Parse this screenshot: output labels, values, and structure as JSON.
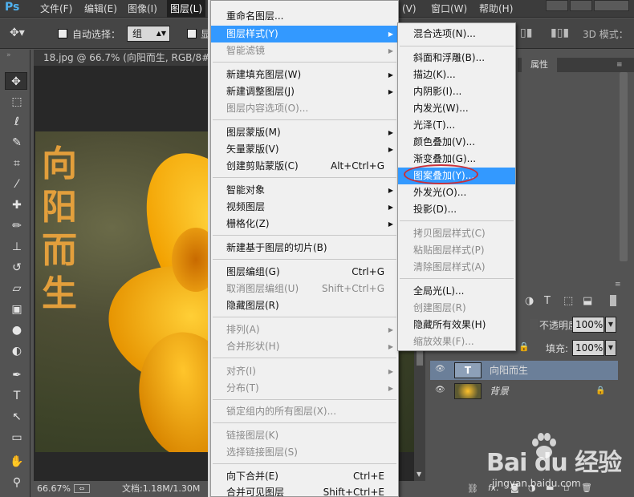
{
  "menubar": {
    "logo": "Ps",
    "items": [
      {
        "label": "文件(F)"
      },
      {
        "label": "编辑(E)"
      },
      {
        "label": "图像(I)"
      },
      {
        "label": "图层(L)"
      },
      {
        "label": "(V)"
      },
      {
        "label": "窗口(W)"
      },
      {
        "label": "帮助(H)"
      }
    ]
  },
  "options": {
    "auto_select_label": "自动选择：",
    "auto_select_value": "组",
    "show_prefix": "显",
    "mode_3d": "3D 模式："
  },
  "document": {
    "tab_title": "18.jpg @ 66.7% (向阳而生, RGB/8#) *",
    "photo_text": [
      "向",
      "阳",
      "而",
      "生"
    ],
    "zoom": "66.67%",
    "doc_size": "文档:1.18M/1.30M"
  },
  "panels": {
    "properties_tab": "属性",
    "opacity_label": "不透明度:",
    "opacity_value": "100%",
    "fill_label": "填充:",
    "fill_value": "100%",
    "layers": [
      {
        "name": "向阳而生",
        "type_icon": "T"
      },
      {
        "name": "背景"
      }
    ]
  },
  "layer_menu": {
    "items": [
      {
        "label": "重命名图层...",
        "disabled": false
      },
      {
        "label": "图层样式(Y)",
        "disabled": false,
        "submenu": true,
        "highlighted": true
      },
      {
        "label": "智能滤镜",
        "disabled": true,
        "submenu": true
      },
      {
        "label": "新建填充图层(W)",
        "disabled": false,
        "submenu": true
      },
      {
        "label": "新建调整图层(J)",
        "disabled": false,
        "submenu": true
      },
      {
        "label": "图层内容选项(O)...",
        "disabled": true
      },
      {
        "label": "图层蒙版(M)",
        "disabled": false,
        "submenu": true
      },
      {
        "label": "矢量蒙版(V)",
        "disabled": false,
        "submenu": true
      },
      {
        "label": "创建剪贴蒙版(C)",
        "shortcut": "Alt+Ctrl+G",
        "disabled": false
      },
      {
        "label": "智能对象",
        "disabled": false,
        "submenu": true
      },
      {
        "label": "视频图层",
        "disabled": false,
        "submenu": true
      },
      {
        "label": "栅格化(Z)",
        "disabled": false,
        "submenu": true
      },
      {
        "label": "新建基于图层的切片(B)",
        "disabled": false
      },
      {
        "label": "图层编组(G)",
        "shortcut": "Ctrl+G",
        "disabled": false
      },
      {
        "label": "取消图层编组(U)",
        "shortcut": "Shift+Ctrl+G",
        "disabled": true
      },
      {
        "label": "隐藏图层(R)",
        "disabled": false
      },
      {
        "label": "排列(A)",
        "disabled": true,
        "submenu": true
      },
      {
        "label": "合并形状(H)",
        "disabled": true,
        "submenu": true
      },
      {
        "label": "对齐(I)",
        "disabled": true,
        "submenu": true
      },
      {
        "label": "分布(T)",
        "disabled": true,
        "submenu": true
      },
      {
        "label": "锁定组内的所有图层(X)...",
        "disabled": true
      },
      {
        "label": "链接图层(K)",
        "disabled": true
      },
      {
        "label": "选择链接图层(S)",
        "disabled": true
      },
      {
        "label": "向下合并(E)",
        "shortcut": "Ctrl+E",
        "disabled": false
      },
      {
        "label": "合并可见图层",
        "shortcut": "Shift+Ctrl+E",
        "disabled": false
      }
    ]
  },
  "style_menu": {
    "items": [
      {
        "label": "混合选项(N)...",
        "disabled": false
      },
      {
        "label": "斜面和浮雕(B)...",
        "disabled": false
      },
      {
        "label": "描边(K)...",
        "disabled": false
      },
      {
        "label": "内阴影(I)...",
        "disabled": false
      },
      {
        "label": "内发光(W)...",
        "disabled": false
      },
      {
        "label": "光泽(T)...",
        "disabled": false
      },
      {
        "label": "颜色叠加(V)...",
        "disabled": false
      },
      {
        "label": "渐变叠加(G)...",
        "disabled": false
      },
      {
        "label": "图案叠加(Y)...",
        "disabled": false,
        "highlighted": true
      },
      {
        "label": "外发光(O)...",
        "disabled": false
      },
      {
        "label": "投影(D)...",
        "disabled": false
      },
      {
        "label": "拷贝图层样式(C)",
        "disabled": true
      },
      {
        "label": "粘贴图层样式(P)",
        "disabled": true
      },
      {
        "label": "清除图层样式(A)",
        "disabled": true
      },
      {
        "label": "全局光(L)...",
        "disabled": false
      },
      {
        "label": "创建图层(R)",
        "disabled": true
      },
      {
        "label": "隐藏所有效果(H)",
        "disabled": false
      },
      {
        "label": "缩放效果(F)...",
        "disabled": true
      }
    ]
  },
  "watermark": {
    "brand": "Bai du 经验",
    "url": "jingyan.baidu.com"
  },
  "colors": {
    "highlight": "#3399ff",
    "annotation_circle": "#c8303a",
    "photo_text": "#f2a73c"
  }
}
